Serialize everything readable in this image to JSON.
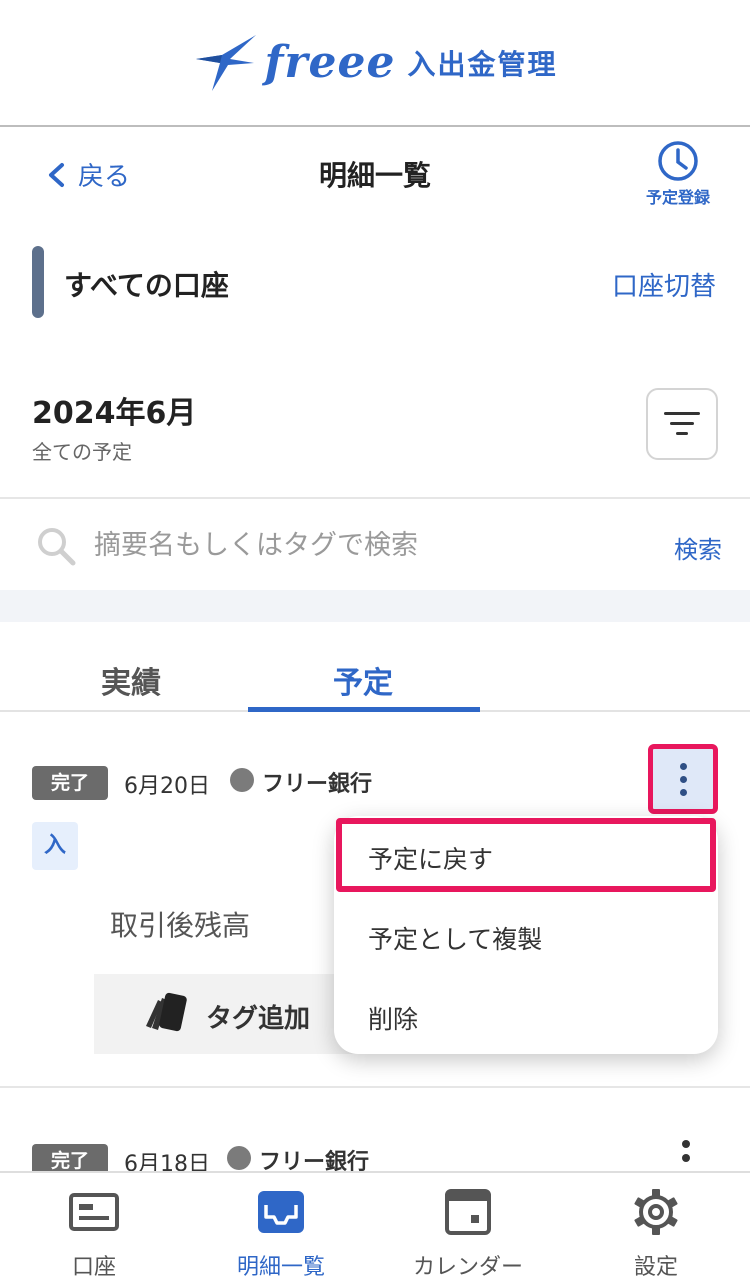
{
  "header": {
    "brand": "freee",
    "product": "入出金管理"
  },
  "nav": {
    "back_label": "戻る",
    "title": "明細一覧",
    "schedule_register": "予定登録"
  },
  "account": {
    "name": "すべての口座",
    "switch_label": "口座切替"
  },
  "period": {
    "month": "2024年6月",
    "filter_label": "全ての予定"
  },
  "search": {
    "placeholder": "摘要名もしくはタグで検索",
    "button": "検索"
  },
  "tabs": [
    {
      "label": "実績",
      "active": false
    },
    {
      "label": "予定",
      "active": true
    }
  ],
  "items": [
    {
      "status": "完了",
      "date": "6月20日",
      "bank": "フリー銀行",
      "type": "入",
      "balance_label": "取引後残高",
      "tag_add_label": "タグ追加"
    },
    {
      "status": "完了",
      "date": "6月18日",
      "bank": "フリー銀行"
    }
  ],
  "menu": {
    "items": [
      "予定に戻す",
      "予定として複製",
      "削除"
    ]
  },
  "bottom_nav": [
    {
      "label": "口座",
      "icon": "account-card-icon",
      "active": false
    },
    {
      "label": "明細一覧",
      "icon": "inbox-icon",
      "active": true
    },
    {
      "label": "カレンダー",
      "icon": "calendar-icon",
      "active": false
    },
    {
      "label": "設定",
      "icon": "gear-icon",
      "active": false
    }
  ],
  "colors": {
    "accent": "#2f67c7",
    "highlight": "#e8175d",
    "badge": "#6b6b6b",
    "account_bar": "#5d708c"
  }
}
